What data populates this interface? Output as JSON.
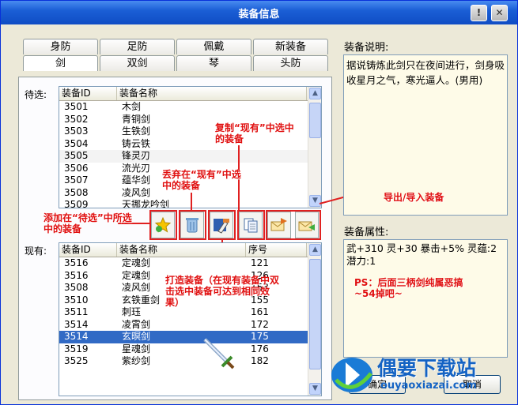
{
  "window": {
    "title": "装备信息",
    "help_label": "!",
    "close_label": "✕"
  },
  "tabs_top": [
    "身防",
    "足防",
    "佩戴",
    "新装备"
  ],
  "tabs_bottom": [
    "剑",
    "双剑",
    "琴",
    "头防"
  ],
  "waiting": {
    "label": "待选:",
    "columns": [
      "装备ID",
      "装备名称"
    ],
    "rows": [
      [
        "3501",
        "木剑"
      ],
      [
        "3502",
        "青铜剑"
      ],
      [
        "3503",
        "生铁剑"
      ],
      [
        "3504",
        "铸云铁"
      ],
      [
        "3505",
        "锋灵刃"
      ],
      [
        "3506",
        "流光刃"
      ],
      [
        "3507",
        "蕴华剑"
      ],
      [
        "3508",
        "凌风剑"
      ],
      [
        "3509",
        "天挪龙吟剑"
      ]
    ]
  },
  "current": {
    "label": "现有:",
    "columns": [
      "装备ID",
      "装备名称",
      "序号"
    ],
    "rows": [
      [
        "3516",
        "定魂剑",
        "121"
      ],
      [
        "3516",
        "定魂剑",
        "126"
      ],
      [
        "3508",
        "凌风剑",
        "153"
      ],
      [
        "3510",
        "玄铁重剑",
        "155"
      ],
      [
        "3511",
        "刺珏",
        "161"
      ],
      [
        "3514",
        "凌霄剑",
        "172"
      ],
      [
        "3514",
        "玄暝剑",
        "175"
      ],
      [
        "3519",
        "星魂剑",
        "176"
      ],
      [
        "3525",
        "紫纱剑",
        "182"
      ]
    ],
    "selected_index": 6
  },
  "description": {
    "label": "装备说明:",
    "text": "据说铸炼此剑只在夜间进行，剑身吸收星月之气，寒光逼人。(男用)"
  },
  "attributes": {
    "label": "装备属性:",
    "text": "武+310 灵+30 暴击+5% 灵蕴:2 潜力:1"
  },
  "annotations": {
    "add": "添加在“待选”中所选中的装备",
    "discard": "丢弃在“现有”中选中的装备",
    "copy": "复制“现有”中选中的装备",
    "export": "导出/导入装备",
    "forge": "打造装备（在现有装备中双击选中装备可达到相同效果）",
    "ps": "PS：后面三柄剑纯属恶搞~54掉吧~"
  },
  "buttons": {
    "ok": "确定",
    "cancel": "取消"
  },
  "watermark": {
    "name": "偶要下载站",
    "url": "ouyaoxiazai.com"
  }
}
